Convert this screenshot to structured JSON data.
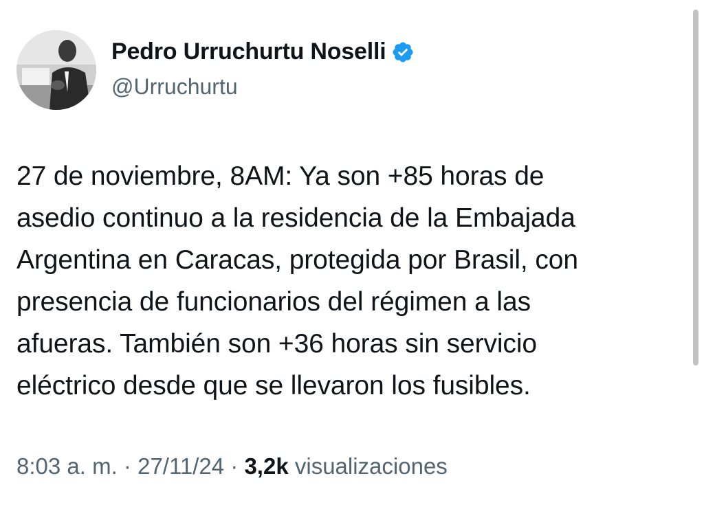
{
  "author": {
    "name": "Pedro Urruchurtu Noselli",
    "handle": "@Urruchurtu",
    "verified": true,
    "verified_color": "#1d9bf0"
  },
  "tweet": {
    "lines": [
      "27 de noviembre, 8AM: Ya son +85 horas de",
      "asedio continuo a la residencia de la Embajada",
      "Argentina en Caracas, protegida por Brasil, con",
      "presencia de funcionarios del régimen a las",
      "afueras. También son +36 horas sin servicio",
      "eléctrico desde que se llevaron los fusibles."
    ]
  },
  "meta": {
    "time": "8:03 a. m.",
    "separator": "·",
    "date": "27/11/24",
    "views_count": "3,2k",
    "views_label": "visualizaciones"
  }
}
